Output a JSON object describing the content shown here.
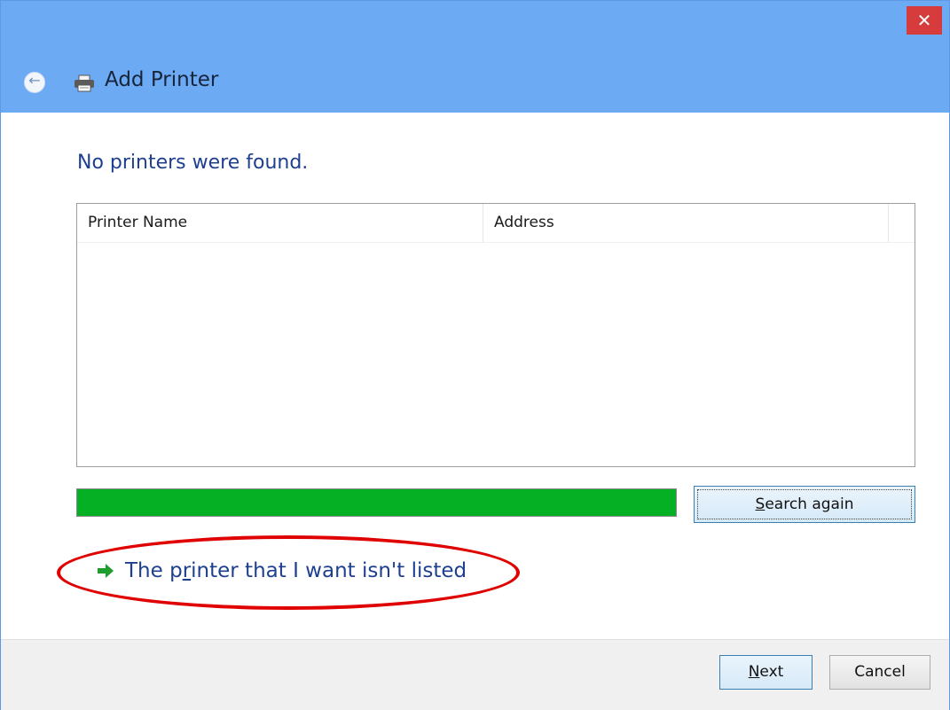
{
  "window": {
    "title": "Add Printer",
    "close_glyph": "✕"
  },
  "icons": {
    "back": "back-arrow-icon",
    "printer": "printer-icon",
    "close": "close-icon",
    "link_arrow": "green-arrow-icon"
  },
  "main": {
    "heading": "No printers were found.",
    "list_columns": [
      "Printer Name",
      "Address"
    ],
    "list_rows": [],
    "progress_fraction": 1.0,
    "progress_color": "#06b025",
    "search_button": {
      "accel": "S",
      "rest": "earch again"
    },
    "link": {
      "before": "The p",
      "accel": "r",
      "after": "inter that I want isn't listed"
    }
  },
  "footer": {
    "next": {
      "accel": "N",
      "rest": "ext"
    },
    "cancel": "Cancel"
  },
  "colors": {
    "titlebar": "#6daaf4",
    "accent_text": "#1e3f90",
    "close_button": "#d63c3c",
    "annotation": "#e00000"
  }
}
